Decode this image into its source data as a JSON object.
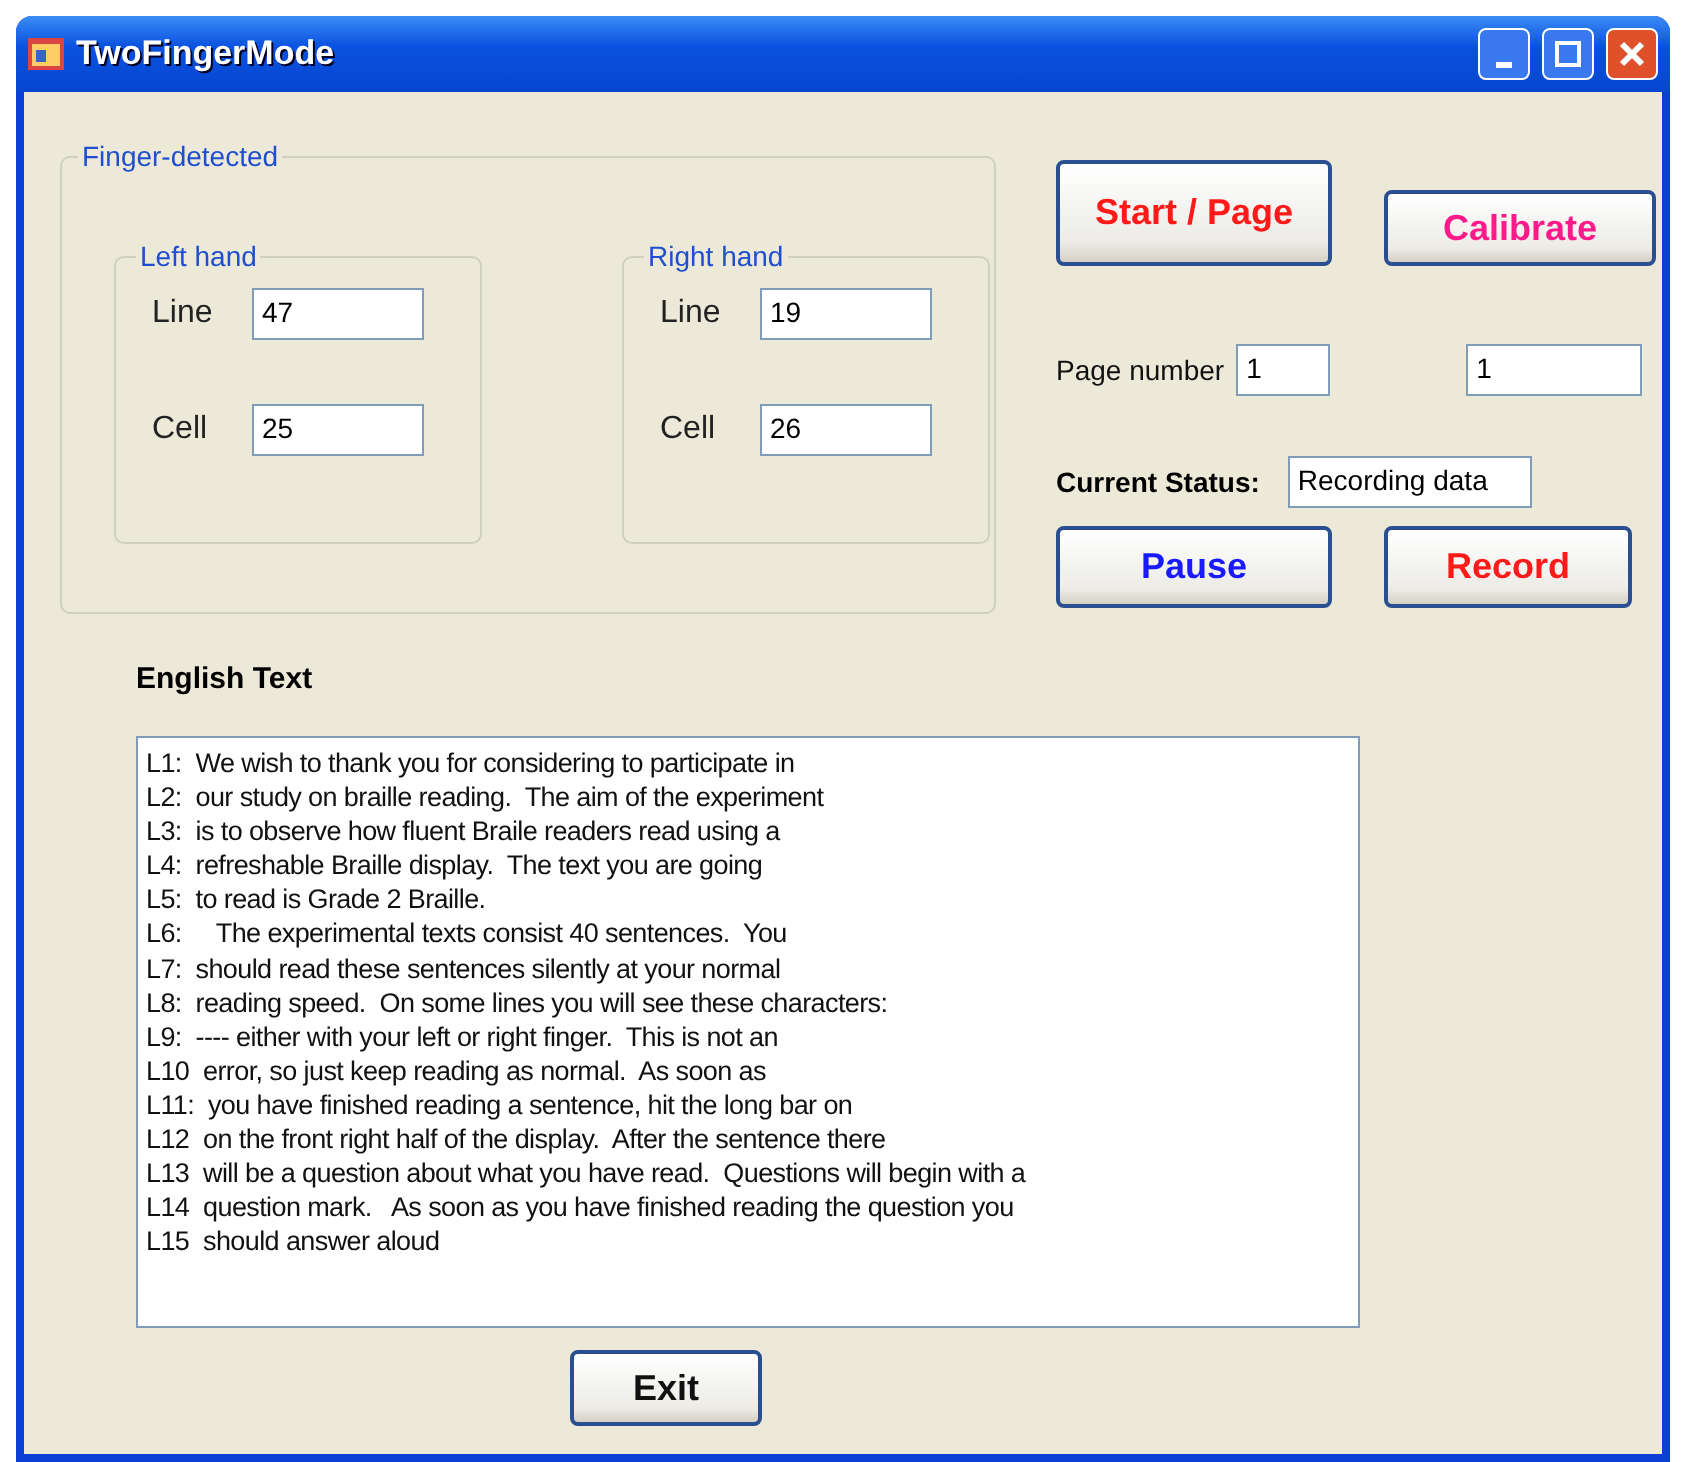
{
  "window": {
    "title": "TwoFingerMode"
  },
  "finger_detected": {
    "title": "Finger-detected",
    "hands": [
      {
        "title": "Left hand",
        "fields": [
          {
            "label": "Line",
            "value": "47"
          },
          {
            "label": "Cell",
            "value": "25"
          }
        ]
      },
      {
        "title": "Right hand",
        "fields": [
          {
            "label": "Line",
            "value": "19"
          },
          {
            "label": "Cell",
            "value": "26"
          }
        ]
      }
    ]
  },
  "top_buttons": [
    {
      "label": "Start / Page",
      "color": "#ff1a1a"
    },
    {
      "label": "Calibrate",
      "color": "#ff1a8c"
    }
  ],
  "page_number": {
    "label": "Page number",
    "value": "1",
    "second_value": "1"
  },
  "status": {
    "label": "Current Status:",
    "value": "Recording data"
  },
  "action_buttons": [
    {
      "label": "Pause",
      "color": "#1a1aff"
    },
    {
      "label": "Record",
      "color": "#ff1a1a"
    }
  ],
  "english_text": {
    "label": "English Text",
    "lines": [
      "L1:  We wish to thank you for considering to participate in",
      "L2:  our study on braille reading.  The aim of the experiment",
      "L3:  is to observe how fluent Braile readers read using a",
      "L4:  refreshable Braille display.  The text you are going",
      "L5:  to read is Grade 2 Braille.",
      "L6:     The experimental texts consist 40 sentences.  You",
      "L7:  should read these sentences silently at your normal",
      "L8:  reading speed.  On some lines you will see these characters:",
      "L9:  ---- either with your left or right finger.  This is not an",
      "L10  error, so just keep reading as normal.  As soon as",
      "L11:  you have finished reading a sentence, hit the long bar on",
      "L12  on the front right half of the display.  After the sentence there",
      "L13  will be a question about what you have read.  Questions will begin with a",
      "L14  question mark.   As soon as you have finished reading the question you",
      "L15  should answer aloud"
    ]
  },
  "exit_button": {
    "label": "Exit"
  }
}
